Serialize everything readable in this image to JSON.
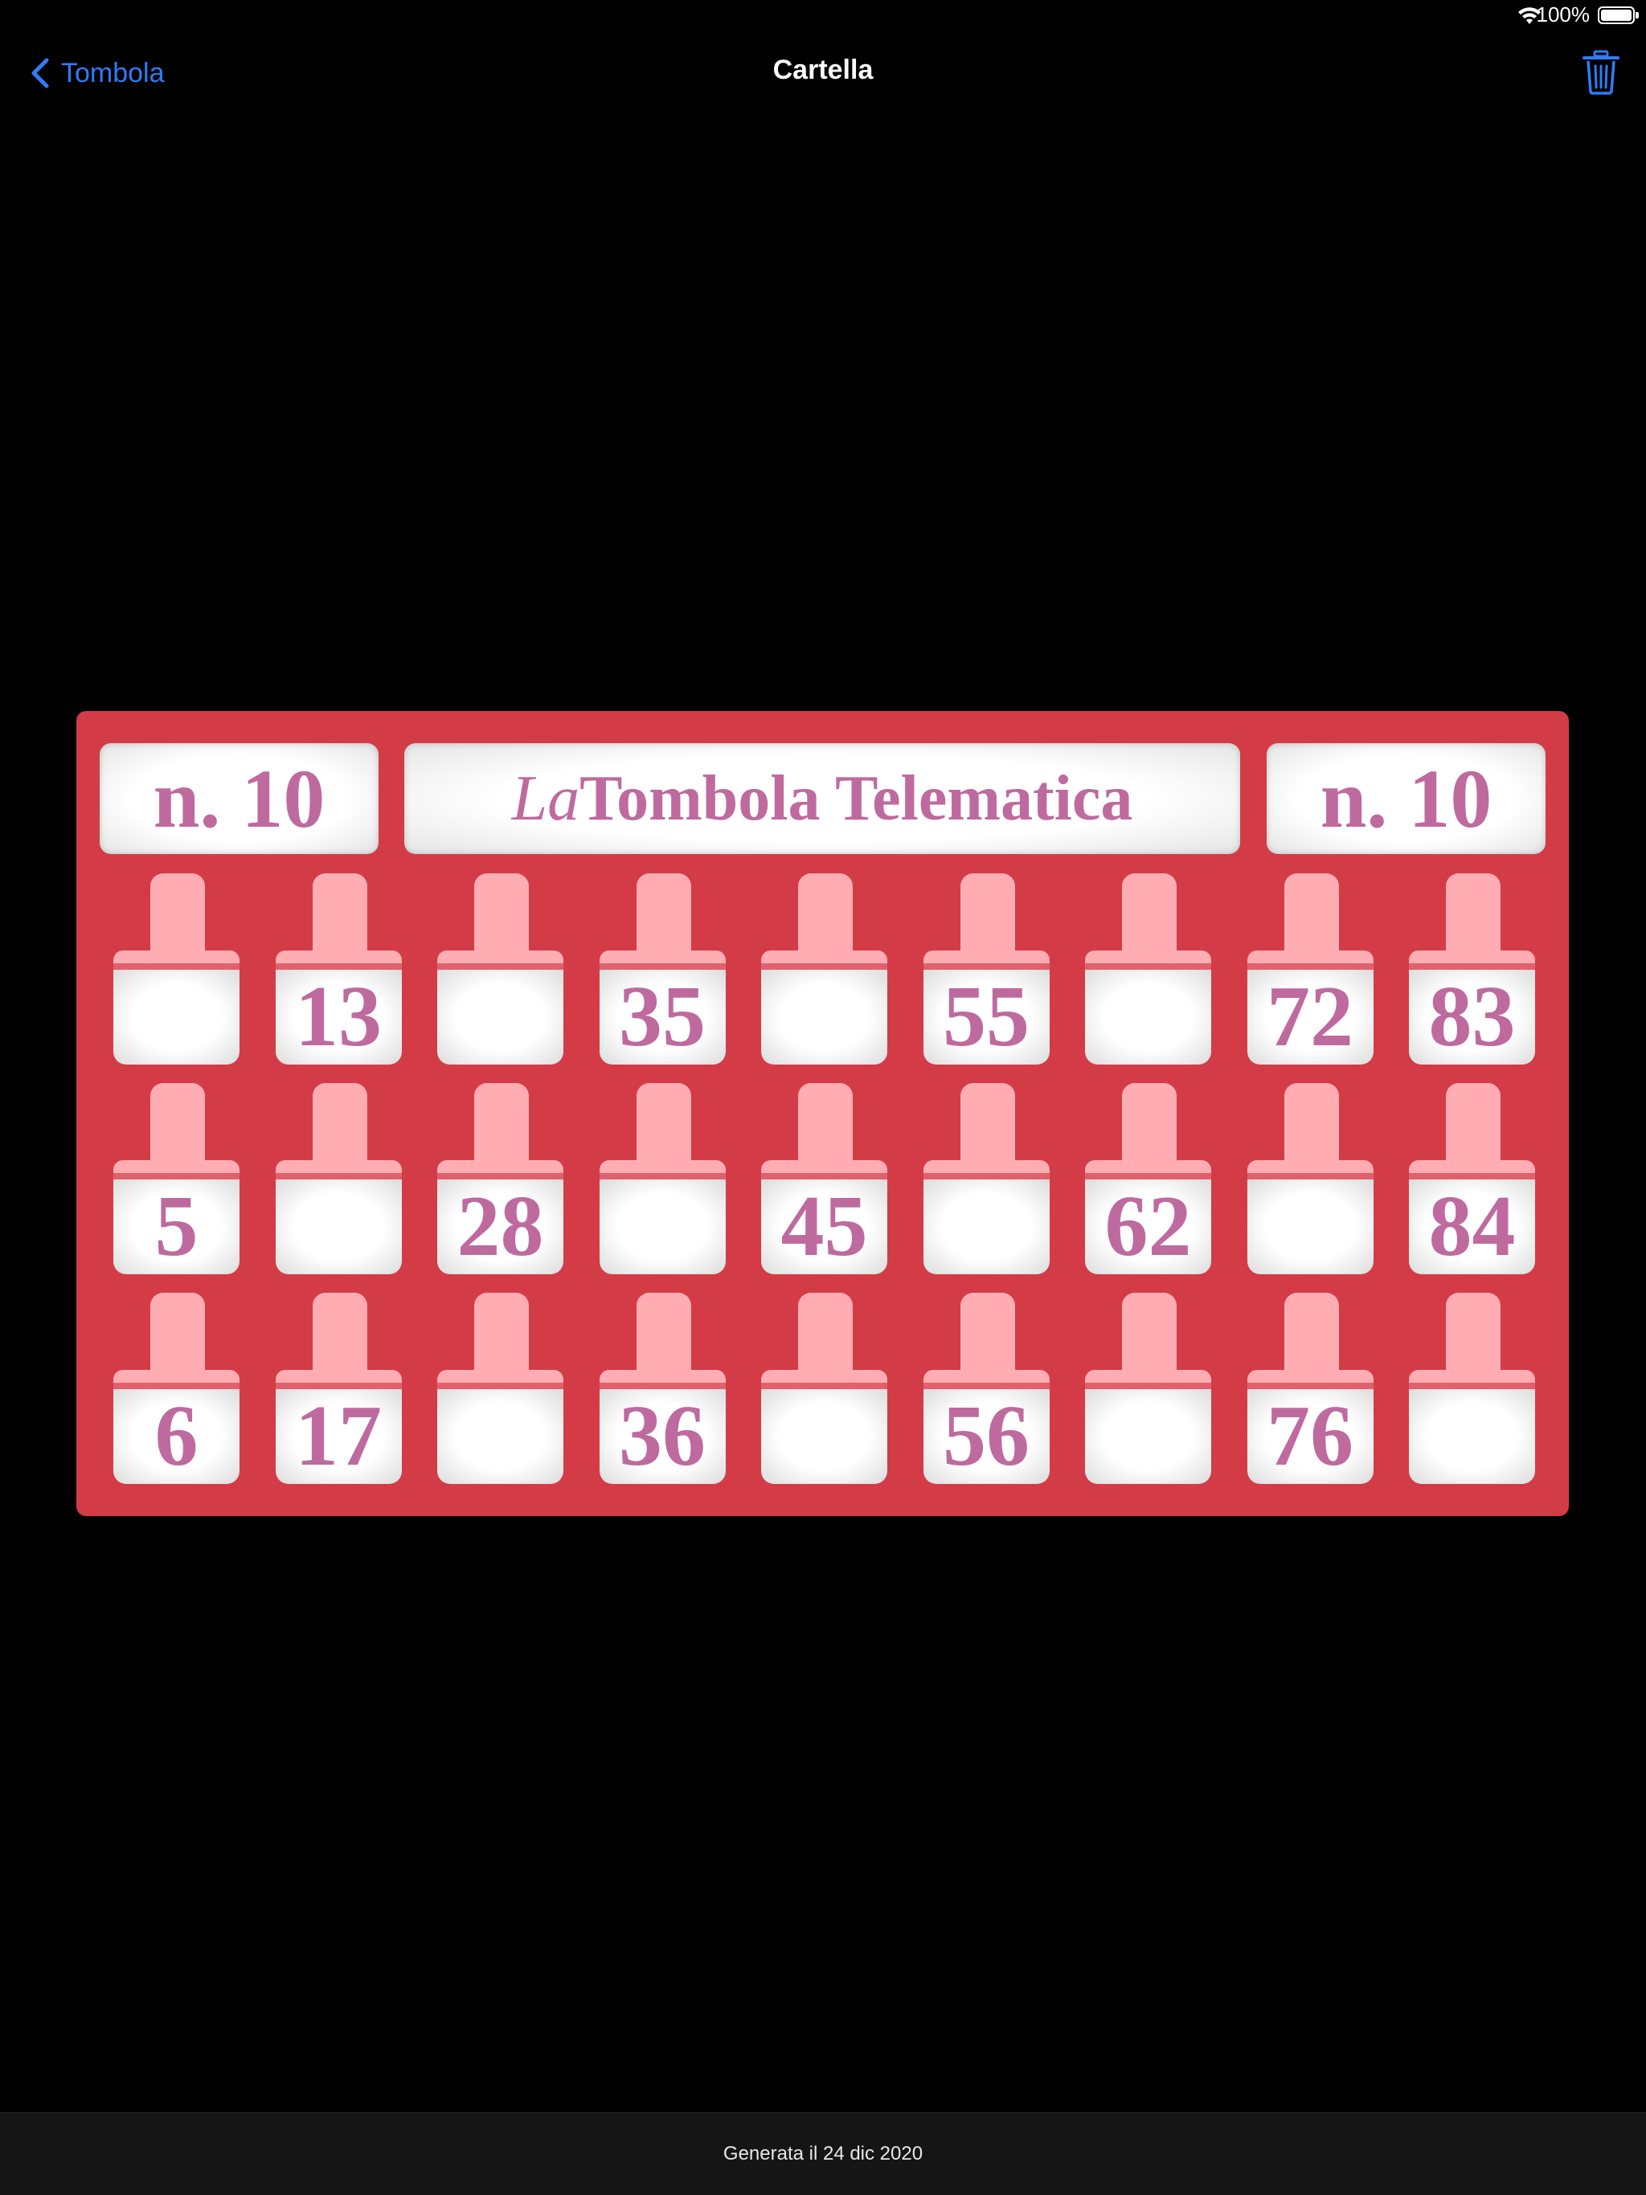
{
  "status_bar": {
    "battery": "100%"
  },
  "nav": {
    "back_label": "Tombola",
    "title": "Cartella"
  },
  "card": {
    "left_number": "n. 10",
    "right_number": "n. 10",
    "title_prefix": "La",
    "title_main": "Tombola Telematica",
    "rows": [
      [
        "",
        "13",
        "",
        "35",
        "",
        "55",
        "",
        "72",
        "83"
      ],
      [
        "5",
        "",
        "28",
        "",
        "45",
        "",
        "62",
        "",
        "84"
      ],
      [
        "6",
        "17",
        "",
        "36",
        "",
        "56",
        "",
        "76",
        ""
      ]
    ]
  },
  "footer": {
    "text": "Generata il 24 dic 2020"
  },
  "colors": {
    "accent": "#2e7cf6",
    "card": "#d33c46",
    "number": "#be6a9f",
    "tab": "#ffadb3"
  }
}
